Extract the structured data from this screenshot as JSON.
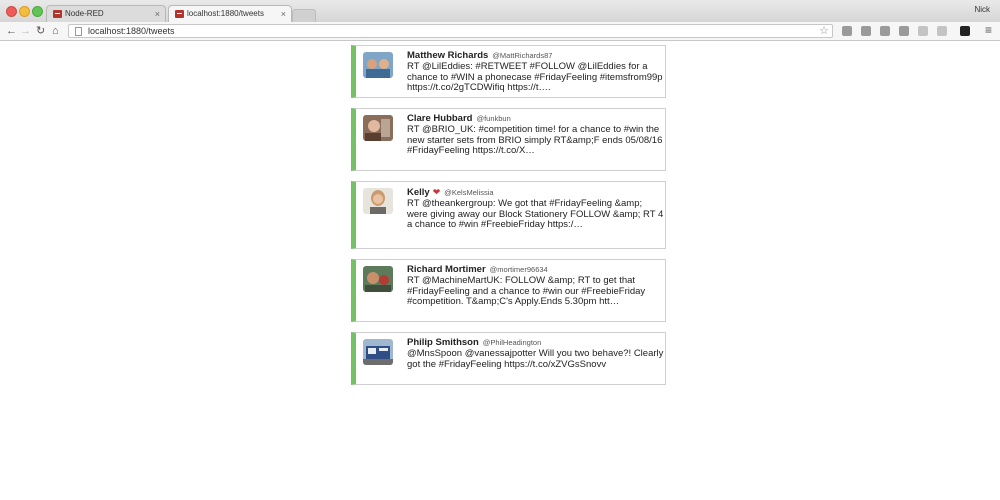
{
  "window": {
    "user": "Nick"
  },
  "tabs": [
    {
      "title": "Node-RED",
      "close": "×"
    },
    {
      "title": "localhost:1880/tweets",
      "close": "×"
    }
  ],
  "toolbar": {
    "url": "localhost:1880/tweets"
  },
  "tweets": [
    {
      "name": "Matthew Richards",
      "handle": "@MattRichards87",
      "text": "RT @LilEddies: #RETWEET #FOLLOW @LilEddies for a chance to #WIN a phonecase #FridayFeeling #itemsfrom99p https://t.co/2gTCDWifiq https://t…."
    },
    {
      "name": "Clare Hubbard",
      "handle": "@funkbun",
      "text": "RT @BRIO_UK: #competition time! for a chance to #win the new starter sets from BRIO simply RT&amp;F ends 05/08/16 #FridayFeeling https://t.co/X…"
    },
    {
      "name": "Kelly",
      "heart": "❤",
      "handle": "@KelsMelissia",
      "text": "RT @theankergroup: We got that #FridayFeeling &amp; were giving away our Block Stationery FOLLOW &amp; RT 4 a chance to #win #FreebieFriday https:/…"
    },
    {
      "name": "Richard Mortimer",
      "handle": "@mortimer96634",
      "text": "RT @MachineMartUK: FOLLOW &amp; RT to get that #FridayFeeling and a chance to #win our #FreebieFriday #competition. T&amp;C's Apply.Ends 5.30pm htt…"
    },
    {
      "name": "Philip Smithson",
      "handle": "@PhilHeadington",
      "text": "@MnsSpoon @vanessajpotter Will you two behave?! Clearly got the #FridayFeeling https://t.co/xZVGsSnovv"
    }
  ],
  "colors": {
    "card_accent": "#74c166"
  }
}
